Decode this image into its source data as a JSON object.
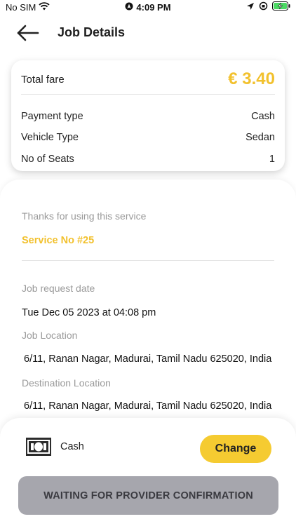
{
  "status_bar": {
    "carrier": "No SIM",
    "time": "4:09 PM"
  },
  "header": {
    "title": "Job Details"
  },
  "fare_card": {
    "total_fare_label": "Total fare",
    "total_fare_value": "€ 3.40",
    "rows": [
      {
        "label": "Payment type",
        "value": "Cash"
      },
      {
        "label": "Vehicle Type",
        "value": "Sedan"
      },
      {
        "label": "No of Seats",
        "value": "1"
      }
    ]
  },
  "details": {
    "thanks_text": "Thanks for using this service",
    "service_no": "Service No #25",
    "job_request_date_label": "Job request date",
    "job_request_date_value": "Tue Dec 05 2023 at 04:08 pm",
    "job_location_label": "Job Location",
    "job_location_value": "6/11, Ranan Nagar, Madurai, Tamil Nadu 625020, India",
    "destination_location_label": "Destination Location",
    "destination_location_value": "6/11, Ranan Nagar, Madurai, Tamil Nadu 625020, India"
  },
  "footer": {
    "payment_method": "Cash",
    "change_label": "Change",
    "waiting_label": "WAITING FOR PROVIDER CONFIRMATION"
  },
  "colors": {
    "accent": "#f2c12e",
    "button_yellow": "#f5cb31",
    "disabled_button": "#a6a6ad"
  },
  "icons": [
    "wifi-icon",
    "navigation-icon",
    "location-arrow-icon",
    "orientation-lock-icon",
    "battery-charging-icon",
    "back-arrow-icon",
    "cash-icon"
  ]
}
